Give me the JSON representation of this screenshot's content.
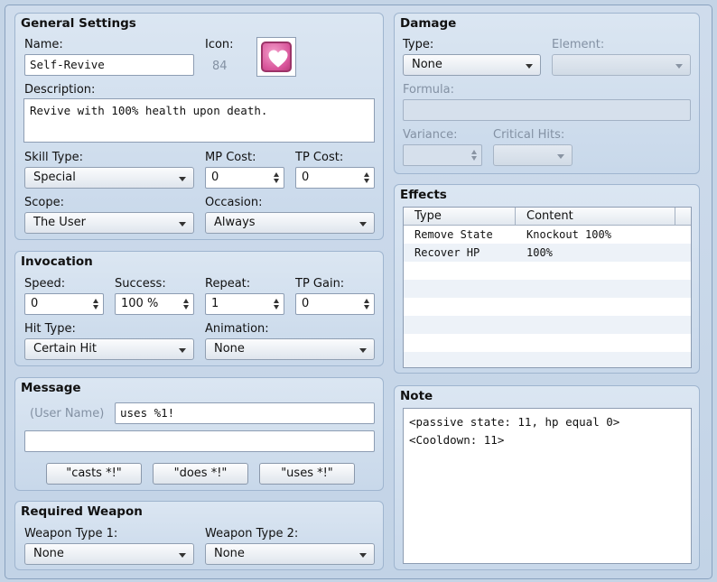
{
  "general": {
    "title": "General Settings",
    "name_label": "Name:",
    "name_value": "Self-Revive",
    "icon_label": "Icon:",
    "icon_index": "84",
    "icon_name": "heart-icon",
    "description_label": "Description:",
    "description_value": "Revive with 100% health upon death.",
    "skill_type_label": "Skill Type:",
    "skill_type_value": "Special",
    "mp_cost_label": "MP Cost:",
    "mp_cost_value": "0",
    "tp_cost_label": "TP Cost:",
    "tp_cost_value": "0",
    "scope_label": "Scope:",
    "scope_value": "The User",
    "occasion_label": "Occasion:",
    "occasion_value": "Always"
  },
  "invocation": {
    "title": "Invocation",
    "speed_label": "Speed:",
    "speed_value": "0",
    "success_label": "Success:",
    "success_value": "100 %",
    "repeat_label": "Repeat:",
    "repeat_value": "1",
    "tp_gain_label": "TP Gain:",
    "tp_gain_value": "0",
    "hit_type_label": "Hit Type:",
    "hit_type_value": "Certain Hit",
    "animation_label": "Animation:",
    "animation_value": "None"
  },
  "message": {
    "title": "Message",
    "user_name_placeholder": "(User Name)",
    "line1_value": "uses %1!",
    "line2_value": "",
    "buttons": [
      "\"casts *!\"",
      "\"does *!\"",
      "\"uses *!\""
    ]
  },
  "required_weapon": {
    "title": "Required Weapon",
    "type1_label": "Weapon Type 1:",
    "type1_value": "None",
    "type2_label": "Weapon Type 2:",
    "type2_value": "None"
  },
  "damage": {
    "title": "Damage",
    "type_label": "Type:",
    "type_value": "None",
    "element_label": "Element:",
    "element_value": "",
    "formula_label": "Formula:",
    "formula_value": "",
    "variance_label": "Variance:",
    "variance_value": "",
    "critical_label": "Critical Hits:",
    "critical_value": ""
  },
  "effects": {
    "title": "Effects",
    "columns": [
      "Type",
      "Content"
    ],
    "rows": [
      {
        "type": "Remove State",
        "content": "Knockout 100%"
      },
      {
        "type": "Recover HP",
        "content": "100%"
      }
    ]
  },
  "note": {
    "title": "Note",
    "lines": [
      "<passive state: 11, hp equal 0>",
      "<Cooldown: 11>"
    ]
  }
}
